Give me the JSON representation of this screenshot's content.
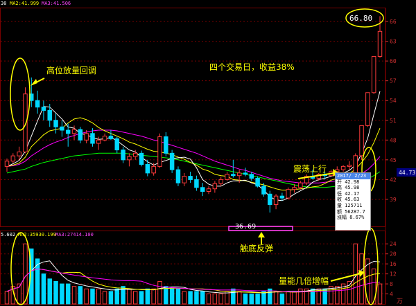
{
  "header": {
    "ma1": "MA2:41.999",
    "ma2": "MA3:41.506",
    "vol1": "MA2:35930.199",
    "vol2": "MA3:27414.100",
    "vol_left": "5.602",
    "price_left": "30"
  },
  "annotations": {
    "high_volume": "高位放量回调",
    "four_days": "四个交易日，收益38%",
    "oscillate": "震荡上行",
    "bottom": "触底反弹",
    "volume_increase": "量能几倍增幅",
    "low_price": "36.69",
    "high_price": "66.80"
  },
  "price_axis": [
    "66",
    "63",
    "60",
    "57",
    "54",
    "51",
    "48",
    "45",
    "42",
    "39"
  ],
  "volume_axis": [
    "24",
    "20",
    "16",
    "12",
    "8",
    "4"
  ],
  "current_price": "44.73",
  "volume_unit": "万",
  "tooltip": {
    "date": "2017/ 2/23",
    "rows": [
      {
        "k": "开",
        "v": "42.98"
      },
      {
        "k": "高",
        "v": "45.98"
      },
      {
        "k": "低",
        "v": "42.17"
      },
      {
        "k": "收",
        "v": "45.63"
      },
      {
        "k": "量",
        "v": "125711"
      },
      {
        "k": "额",
        "v": "56287.7"
      },
      {
        "k": "涨幅",
        "v": "8.67%"
      }
    ]
  },
  "chart_data": {
    "type": "candlestick",
    "ylim": [
      35,
      68
    ],
    "vol_ylim": [
      0,
      26
    ],
    "candles": [
      [
        44,
        45.2,
        43.2,
        44.8,
        5
      ],
      [
        44.8,
        46,
        44.5,
        45.6,
        7
      ],
      [
        45.6,
        47,
        45,
        46.2,
        8
      ],
      [
        46.2,
        56,
        46,
        55,
        24
      ],
      [
        55,
        57.5,
        53,
        54,
        22
      ],
      [
        54,
        55.5,
        52,
        53,
        18
      ],
      [
        53,
        54,
        51,
        52.5,
        12
      ],
      [
        52.5,
        53.5,
        50,
        51,
        10
      ],
      [
        51,
        52,
        49,
        50,
        9
      ],
      [
        50,
        51,
        48.5,
        49.5,
        8
      ],
      [
        49.5,
        50.5,
        47,
        49,
        8
      ],
      [
        49,
        50.2,
        48,
        49.6,
        7
      ],
      [
        49.6,
        50,
        47.5,
        48,
        7
      ],
      [
        48,
        49.5,
        47.5,
        49,
        6
      ],
      [
        49,
        49.8,
        47,
        47.5,
        6
      ],
      [
        47.5,
        48.5,
        46.5,
        48,
        6
      ],
      [
        48,
        49,
        47.8,
        48.6,
        5
      ],
      [
        48.6,
        49.5,
        48,
        48.2,
        5
      ],
      [
        48.2,
        48.5,
        46,
        46.5,
        6
      ],
      [
        46.5,
        47,
        44.5,
        45,
        7
      ],
      [
        45,
        46,
        44,
        45.5,
        6
      ],
      [
        45.5,
        46.5,
        45,
        46,
        5
      ],
      [
        46,
        46.4,
        44,
        44.3,
        5
      ],
      [
        44.3,
        45,
        42.5,
        43,
        6
      ],
      [
        43,
        44.5,
        42.6,
        44,
        6
      ],
      [
        44,
        49,
        43.8,
        48.5,
        9
      ],
      [
        48.5,
        49.2,
        45.5,
        46,
        7
      ],
      [
        46,
        46.5,
        43,
        43.5,
        6
      ],
      [
        43.5,
        44,
        41,
        41.5,
        6
      ],
      [
        41.5,
        43,
        41,
        42.5,
        5
      ],
      [
        42.5,
        43.2,
        41.5,
        42,
        5
      ],
      [
        42,
        42.6,
        40.3,
        40.8,
        5
      ],
      [
        40.8,
        41.5,
        39.5,
        40.2,
        5
      ],
      [
        40.2,
        41,
        39.8,
        40.6,
        4
      ],
      [
        40.6,
        41.8,
        40,
        41.4,
        4
      ],
      [
        41.4,
        42.4,
        41,
        42,
        4
      ],
      [
        42,
        43.2,
        41.8,
        42.8,
        5
      ],
      [
        42.8,
        45,
        42.3,
        42.6,
        6
      ],
      [
        42.6,
        43.5,
        41.5,
        43,
        5
      ],
      [
        43,
        43.8,
        42.5,
        42.8,
        4
      ],
      [
        42.8,
        43.2,
        41.8,
        42.2,
        4
      ],
      [
        42.2,
        42.5,
        40.8,
        41,
        4
      ],
      [
        41,
        41.5,
        39.4,
        39.8,
        5
      ],
      [
        39.8,
        40.3,
        37,
        38.2,
        6
      ],
      [
        38.2,
        39.8,
        37.5,
        39.5,
        5
      ],
      [
        39.5,
        40,
        38.8,
        39.2,
        4
      ],
      [
        39.2,
        40.8,
        39,
        40.5,
        5
      ],
      [
        40.5,
        41.3,
        40,
        40.8,
        5
      ],
      [
        40.8,
        41.8,
        40.5,
        41.5,
        6
      ],
      [
        41.5,
        42.8,
        41.2,
        42.5,
        6
      ],
      [
        42.5,
        43.5,
        42,
        42.2,
        6
      ],
      [
        42.2,
        43,
        41.8,
        42.8,
        6
      ],
      [
        42.8,
        43.2,
        42,
        42.6,
        6
      ],
      [
        42.6,
        43.5,
        42.5,
        43.2,
        7
      ],
      [
        43.2,
        44,
        43,
        43.5,
        7
      ],
      [
        43.5,
        44.2,
        43.2,
        44,
        8
      ],
      [
        44,
        44.8,
        43.5,
        44.2,
        9
      ],
      [
        42.98,
        45.98,
        42.17,
        45.63,
        24
      ],
      [
        45.63,
        50.2,
        45,
        50.2,
        20
      ],
      [
        50.2,
        55.2,
        50,
        55.2,
        18
      ],
      [
        55.2,
        60.7,
        55,
        60.7,
        14
      ],
      [
        60.7,
        66.8,
        60.5,
        64.5,
        8
      ]
    ],
    "ma5": [
      44,
      44.4,
      44.9,
      46.3,
      48.6,
      50.9,
      53.1,
      53,
      52.1,
      51.2,
      50,
      49.8,
      49,
      48.8,
      48.4,
      48.1,
      48.2,
      48.4,
      47.9,
      47.2,
      46.5,
      46.2,
      45.4,
      44.7,
      44.2,
      44.6,
      44.9,
      45.2,
      45.3,
      45.4,
      45.1,
      43.8,
      42,
      41.3,
      41,
      41,
      41.5,
      41.8,
      41.8,
      41.9,
      41.5,
      41.2,
      40.4,
      39.4,
      38.9,
      38.8,
      39.2,
      39.8,
      40.3,
      40.8,
      41.6,
      42,
      42.2,
      42.5,
      42.8,
      43,
      43.4,
      44.2,
      45.9,
      48.3,
      51.9,
      55.4
    ],
    "ma10": [
      44,
      44.2,
      44.5,
      45.4,
      47,
      47.9,
      48.8,
      49.4,
      49.6,
      49.8,
      50.6,
      51.2,
      51.4,
      51.1,
      50.6,
      49.9,
      49.4,
      49,
      48.6,
      48.2,
      47.7,
      47.4,
      47,
      46.6,
      46.3,
      46.2,
      46,
      45.8,
      45.4,
      45.1,
      44.6,
      44.2,
      43.6,
      43.3,
      42.8,
      42.6,
      42.5,
      42,
      41.9,
      41.8,
      41.6,
      41.4,
      41.2,
      40.9,
      40.6,
      40.4,
      40.4,
      40.5,
      40.6,
      40.7,
      40.9,
      41,
      41.4,
      41.9,
      42.2,
      42.5,
      42.9,
      43.6,
      44.6,
      45.8,
      47.6,
      49.8
    ],
    "ma20": [
      44,
      44.1,
      44.3,
      44.8,
      45.6,
      46.2,
      46.8,
      47.3,
      47.7,
      48,
      48.4,
      48.7,
      49,
      49.2,
      49.4,
      49.5,
      49.5,
      49.5,
      49.4,
      49.2,
      49,
      48.8,
      48.6,
      48.3,
      48,
      47.8,
      47.5,
      47.2,
      46.9,
      46.6,
      46.3,
      46,
      45.6,
      45.2,
      44.8,
      44.5,
      44.2,
      43.9,
      43.6,
      43.4,
      43.1,
      42.8,
      42.5,
      42.2,
      42,
      41.8,
      41.7,
      41.6,
      41.5,
      41.5,
      41.5,
      41.5,
      41.6,
      41.7,
      41.8,
      41.9,
      42.1,
      42.4,
      42.9,
      43.5,
      44.4,
      45.5
    ],
    "ma60": [
      43,
      43.2,
      43.4,
      43.6,
      44,
      44.3,
      44.6,
      44.8,
      45,
      45.2,
      45.4,
      45.6,
      45.7,
      45.8,
      45.9,
      46,
      46,
      46,
      46,
      46,
      45.9,
      45.8,
      45.7,
      45.6,
      45.5,
      45.4,
      45.3,
      45.2,
      45,
      44.8,
      44.6,
      44.4,
      44.2,
      44,
      43.8,
      43.6,
      43.4,
      43.2,
      43,
      42.8,
      42.6,
      42.4,
      42.2,
      42,
      41.8,
      41.6,
      41.4,
      41.2,
      41,
      40.9,
      40.8,
      40.8,
      40.8,
      40.9,
      41,
      41.1,
      41.2,
      41.4,
      41.7,
      42.1,
      42.6,
      43.2
    ],
    "colors": {
      "up": "#ff3b3b",
      "down": "#00d8ff",
      "ma5": "#ffffff",
      "ma10": "#ffff00",
      "ma20": "#ff00ff",
      "ma60": "#00ff00",
      "grid": "#7a0000",
      "annotation": "#ffff00"
    }
  }
}
